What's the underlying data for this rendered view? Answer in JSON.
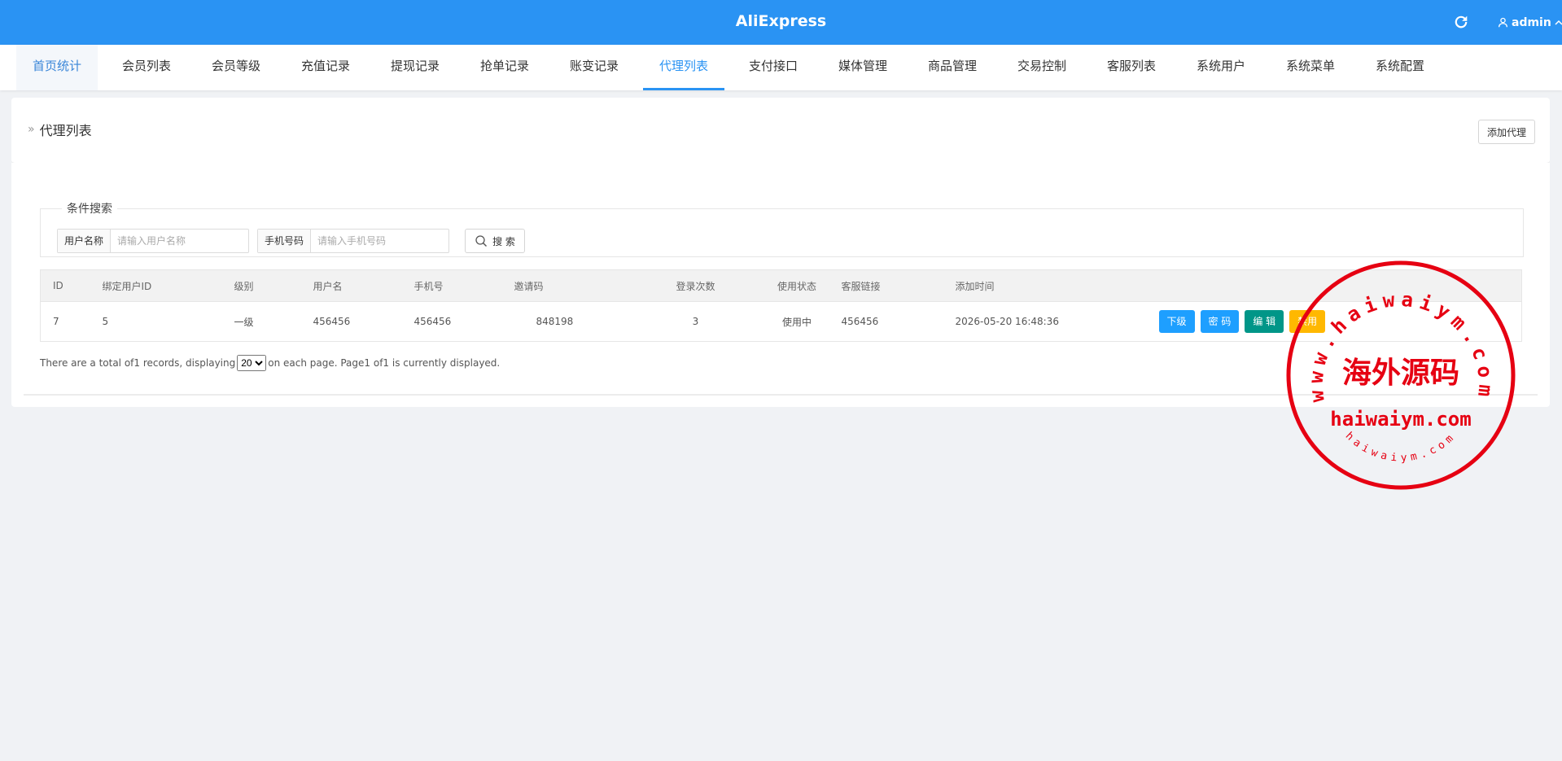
{
  "header": {
    "brand": "AliExpress",
    "user": "admin",
    "icons": {
      "refresh": "refresh-icon",
      "user": "user-icon",
      "dropdown": "chevron-up-icon"
    }
  },
  "nav": {
    "tabs": [
      {
        "label": "首页统计"
      },
      {
        "label": "会员列表"
      },
      {
        "label": "会员等级"
      },
      {
        "label": "充值记录"
      },
      {
        "label": "提现记录"
      },
      {
        "label": "抢单记录"
      },
      {
        "label": "账变记录"
      },
      {
        "label": "代理列表"
      },
      {
        "label": "支付接口"
      },
      {
        "label": "媒体管理"
      },
      {
        "label": "商品管理"
      },
      {
        "label": "交易控制"
      },
      {
        "label": "客服列表"
      },
      {
        "label": "系统用户"
      },
      {
        "label": "系统菜单"
      },
      {
        "label": "系统配置"
      }
    ],
    "active_index": 7
  },
  "page": {
    "title": "代理列表",
    "add_button": "添加代理"
  },
  "search": {
    "legend": "条件搜索",
    "username_label": "用户名称",
    "username_placeholder": "请输入用户名称",
    "username_value": "",
    "phone_label": "手机号码",
    "phone_placeholder": "请输入手机号码",
    "phone_value": "",
    "button": "搜 索"
  },
  "table": {
    "headers": [
      "ID",
      "绑定用户ID",
      "级别",
      "用户名",
      "手机号",
      "邀请码",
      "登录次数",
      "使用状态",
      "客服链接",
      "添加时间"
    ],
    "rows": [
      {
        "id": "7",
        "bind_user_id": "5",
        "level": "一级",
        "username": "456456",
        "phone": "456456",
        "invite_code": "848198",
        "login_count": "3",
        "status": "使用中",
        "service_link": "456456",
        "added_time": "2026-05-20 16:48:36",
        "actions": [
          "下级",
          "密 码",
          "编 辑",
          "禁用"
        ]
      }
    ]
  },
  "pager": {
    "prefix": "There are a total of1 records, displaying",
    "page_size": "20",
    "suffix": " on each page. Page1 of1 is currently displayed."
  },
  "watermark": {
    "top_arc": "www.haiwaiym.com",
    "center": "海外源码",
    "middle": "haiwaiym.com",
    "bottom_arc": "haiwaiym.com",
    "color": "#e60012"
  },
  "colors": {
    "topbar": "#2a93f3",
    "accent": "#2a93f3",
    "status_green": "#1aa01a",
    "btn_blue": "#1e9fff",
    "btn_teal": "#009688",
    "btn_yellow": "#ffb800"
  }
}
